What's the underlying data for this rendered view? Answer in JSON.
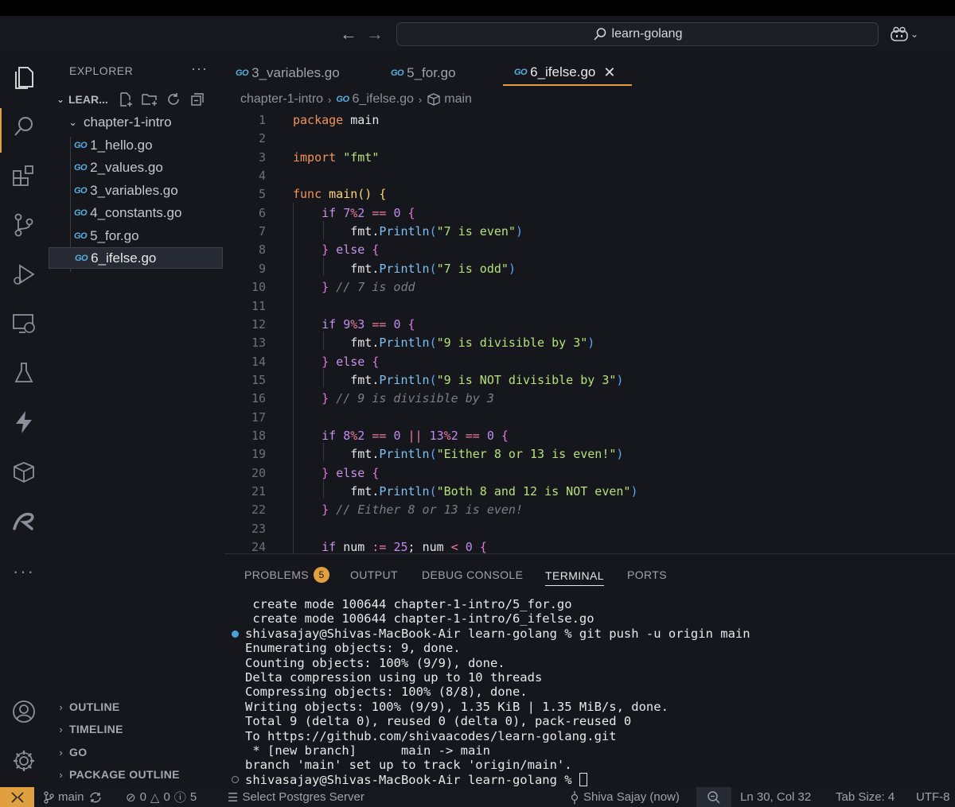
{
  "title_bar": {
    "search_text": "learn-golang"
  },
  "sidebar": {
    "title": "EXPLORER",
    "more": "···",
    "root_folder": "LEAR...",
    "folder": "chapter-1-intro",
    "files": [
      "1_hello.go",
      "2_values.go",
      "3_variables.go",
      "4_constants.go",
      "5_for.go",
      "6_ifelse.go"
    ],
    "sections": [
      "OUTLINE",
      "TIMELINE",
      "GO",
      "PACKAGE OUTLINE"
    ]
  },
  "editor": {
    "go_badge": "GO",
    "tabs": [
      "3_variables.go",
      "5_for.go",
      "6_ifelse.go"
    ],
    "close_glyph": "✕",
    "breadcrumb": [
      "chapter-1-intro",
      "6_ifelse.go",
      "main"
    ],
    "line_numbers": [
      "1",
      "2",
      "3",
      "4",
      "5",
      "6",
      "7",
      "8",
      "9",
      "10",
      "11",
      "12",
      "13",
      "14",
      "15",
      "16",
      "17",
      "18",
      "19",
      "20",
      "21",
      "22",
      "23",
      "24"
    ],
    "code_lines": [
      [
        [
          "kw",
          "package"
        ],
        [
          "id",
          " "
        ],
        [
          "id",
          "main"
        ]
      ],
      [],
      [
        [
          "kw",
          "import"
        ],
        [
          "id",
          " "
        ],
        [
          "str",
          "\"fmt\""
        ]
      ],
      [],
      [
        [
          "kw",
          "func"
        ],
        [
          "id",
          " "
        ],
        [
          "fn",
          "main"
        ],
        [
          "br1",
          "()"
        ],
        [
          "id",
          " "
        ],
        [
          "br1",
          "{"
        ]
      ],
      [
        [
          "id",
          "    "
        ],
        [
          "kw2",
          "if"
        ],
        [
          "id",
          " "
        ],
        [
          "num",
          "7"
        ],
        [
          "op",
          "%"
        ],
        [
          "num",
          "2"
        ],
        [
          "id",
          " "
        ],
        [
          "op",
          "=="
        ],
        [
          "id",
          " "
        ],
        [
          "num",
          "0"
        ],
        [
          "id",
          " "
        ],
        [
          "br2",
          "{"
        ]
      ],
      [
        [
          "id",
          "        "
        ],
        [
          "id",
          "fmt"
        ],
        [
          "pun",
          "."
        ],
        [
          "mth",
          "Println"
        ],
        [
          "br3",
          "("
        ],
        [
          "str",
          "\"7 is even\""
        ],
        [
          "br3",
          ")"
        ]
      ],
      [
        [
          "id",
          "    "
        ],
        [
          "br2",
          "}"
        ],
        [
          "id",
          " "
        ],
        [
          "kw2",
          "else"
        ],
        [
          "id",
          " "
        ],
        [
          "br2",
          "{"
        ]
      ],
      [
        [
          "id",
          "        "
        ],
        [
          "id",
          "fmt"
        ],
        [
          "pun",
          "."
        ],
        [
          "mth",
          "Println"
        ],
        [
          "br3",
          "("
        ],
        [
          "str",
          "\"7 is odd\""
        ],
        [
          "br3",
          ")"
        ]
      ],
      [
        [
          "id",
          "    "
        ],
        [
          "br2",
          "}"
        ],
        [
          "id",
          " "
        ],
        [
          "cmt",
          "// 7 is odd"
        ]
      ],
      [],
      [
        [
          "id",
          "    "
        ],
        [
          "kw2",
          "if"
        ],
        [
          "id",
          " "
        ],
        [
          "num",
          "9"
        ],
        [
          "op",
          "%"
        ],
        [
          "num",
          "3"
        ],
        [
          "id",
          " "
        ],
        [
          "op",
          "=="
        ],
        [
          "id",
          " "
        ],
        [
          "num",
          "0"
        ],
        [
          "id",
          " "
        ],
        [
          "br2",
          "{"
        ]
      ],
      [
        [
          "id",
          "        "
        ],
        [
          "id",
          "fmt"
        ],
        [
          "pun",
          "."
        ],
        [
          "mth",
          "Println"
        ],
        [
          "br3",
          "("
        ],
        [
          "str",
          "\"9 is divisible by 3\""
        ],
        [
          "br3",
          ")"
        ]
      ],
      [
        [
          "id",
          "    "
        ],
        [
          "br2",
          "}"
        ],
        [
          "id",
          " "
        ],
        [
          "kw2",
          "else"
        ],
        [
          "id",
          " "
        ],
        [
          "br2",
          "{"
        ]
      ],
      [
        [
          "id",
          "        "
        ],
        [
          "id",
          "fmt"
        ],
        [
          "pun",
          "."
        ],
        [
          "mth",
          "Println"
        ],
        [
          "br3",
          "("
        ],
        [
          "str",
          "\"9 is NOT divisible by 3\""
        ],
        [
          "br3",
          ")"
        ]
      ],
      [
        [
          "id",
          "    "
        ],
        [
          "br2",
          "}"
        ],
        [
          "id",
          " "
        ],
        [
          "cmt",
          "// 9 is divisible by 3"
        ]
      ],
      [],
      [
        [
          "id",
          "    "
        ],
        [
          "kw2",
          "if"
        ],
        [
          "id",
          " "
        ],
        [
          "num",
          "8"
        ],
        [
          "op",
          "%"
        ],
        [
          "num",
          "2"
        ],
        [
          "id",
          " "
        ],
        [
          "op",
          "=="
        ],
        [
          "id",
          " "
        ],
        [
          "num",
          "0"
        ],
        [
          "id",
          " "
        ],
        [
          "op",
          "||"
        ],
        [
          "id",
          " "
        ],
        [
          "num",
          "13"
        ],
        [
          "op",
          "%"
        ],
        [
          "num",
          "2"
        ],
        [
          "id",
          " "
        ],
        [
          "op",
          "=="
        ],
        [
          "id",
          " "
        ],
        [
          "num",
          "0"
        ],
        [
          "id",
          " "
        ],
        [
          "br2",
          "{"
        ]
      ],
      [
        [
          "id",
          "        "
        ],
        [
          "id",
          "fmt"
        ],
        [
          "pun",
          "."
        ],
        [
          "mth",
          "Println"
        ],
        [
          "br3",
          "("
        ],
        [
          "str",
          "\"Either 8 or 13 is even!\""
        ],
        [
          "br3",
          ")"
        ]
      ],
      [
        [
          "id",
          "    "
        ],
        [
          "br2",
          "}"
        ],
        [
          "id",
          " "
        ],
        [
          "kw2",
          "else"
        ],
        [
          "id",
          " "
        ],
        [
          "br2",
          "{"
        ]
      ],
      [
        [
          "id",
          "        "
        ],
        [
          "id",
          "fmt"
        ],
        [
          "pun",
          "."
        ],
        [
          "mth",
          "Println"
        ],
        [
          "br3",
          "("
        ],
        [
          "str",
          "\"Both 8 and 12 is NOT even\""
        ],
        [
          "br3",
          ")"
        ]
      ],
      [
        [
          "id",
          "    "
        ],
        [
          "br2",
          "}"
        ],
        [
          "id",
          " "
        ],
        [
          "cmt",
          "// Either 8 or 13 is even!"
        ]
      ],
      [],
      [
        [
          "id",
          "    "
        ],
        [
          "kw2",
          "if"
        ],
        [
          "id",
          " "
        ],
        [
          "id",
          "num"
        ],
        [
          "id",
          " "
        ],
        [
          "op",
          ":="
        ],
        [
          "id",
          " "
        ],
        [
          "num",
          "25"
        ],
        [
          "pun",
          ";"
        ],
        [
          "id",
          " "
        ],
        [
          "id",
          "num"
        ],
        [
          "id",
          " "
        ],
        [
          "op",
          "<"
        ],
        [
          "id",
          " "
        ],
        [
          "num",
          "0"
        ],
        [
          "id",
          " "
        ],
        [
          "br2",
          "{"
        ]
      ]
    ]
  },
  "panel": {
    "tabs": [
      "PROBLEMS",
      "OUTPUT",
      "DEBUG CONSOLE",
      "TERMINAL",
      "PORTS"
    ],
    "problems_count": "5",
    "terminal_lines": [
      " create mode 100644 chapter-1-intro/5_for.go",
      " create mode 100644 chapter-1-intro/6_ifelse.go",
      "shivasajay@Shivas-MacBook-Air learn-golang % git push -u origin main",
      "Enumerating objects: 9, done.",
      "Counting objects: 100% (9/9), done.",
      "Delta compression using up to 10 threads",
      "Compressing objects: 100% (8/8), done.",
      "Writing objects: 100% (9/9), 1.35 KiB | 1.35 MiB/s, done.",
      "Total 9 (delta 0), reused 0 (delta 0), pack-reused 0",
      "To https://github.com/shivaacodes/learn-golang.git",
      " * [new branch]      main -> main",
      "branch 'main' set up to track 'origin/main'.",
      "shivasajay@Shivas-MacBook-Air learn-golang % "
    ]
  },
  "status_bar": {
    "branch": "main",
    "errors": "0",
    "warnings": "0",
    "info": "5",
    "postgres": "Select Postgres Server",
    "author": "Shiva Sajay (now)",
    "position": "Ln 30, Col 32",
    "tab_size": "Tab Size: 4",
    "encoding": "UTF-8"
  },
  "colors": {
    "accent": "#e0a040",
    "background": "#15171d",
    "go_badge": "#59b0e0"
  }
}
